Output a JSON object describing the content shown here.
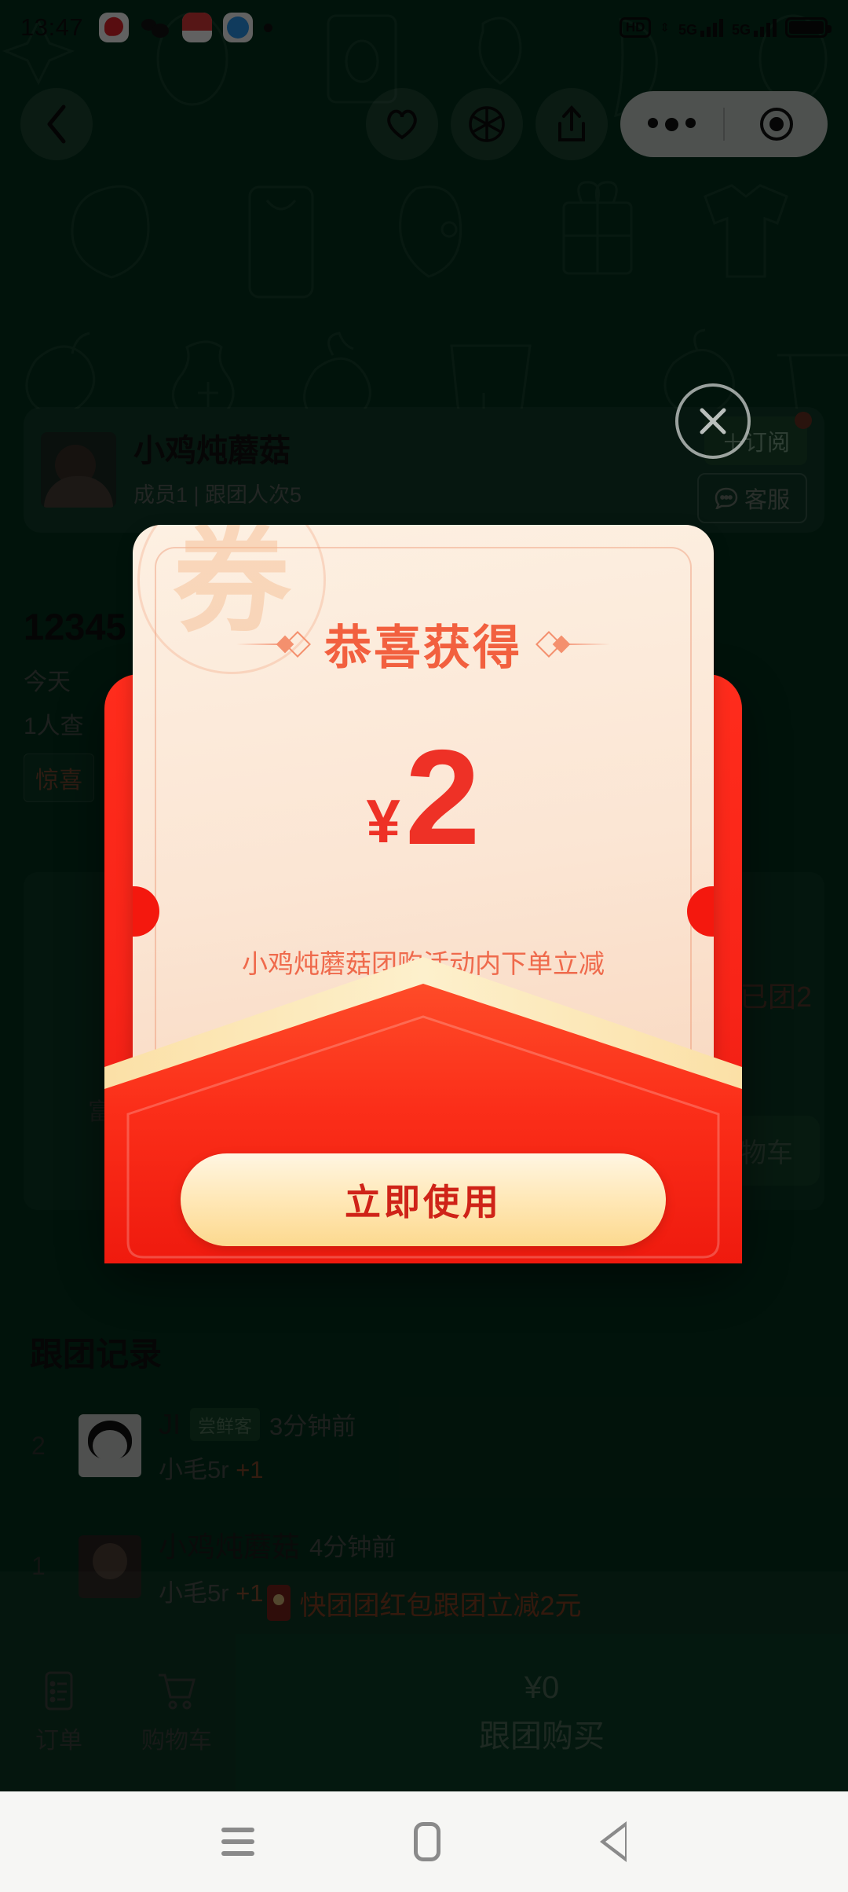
{
  "statusbar": {
    "time": "13:47",
    "network_hd": "HD",
    "net1": "5G",
    "net2": "5G",
    "icons": [
      "location-app-icon",
      "wechat-icon",
      "coupon-app-icon",
      "browser-app-icon",
      "notification-dot"
    ]
  },
  "nav": {
    "back": "‹",
    "favorite_icon": "heart-icon",
    "camera_icon": "aperture-icon",
    "share_icon": "share-icon",
    "more_icon": "more-dots-icon",
    "target_icon": "target-icon"
  },
  "shop": {
    "name": "小鸡炖蘑菇",
    "meta": "成员1 | 跟团人次5",
    "subscribe_label": "＋订阅",
    "service_label": "客服",
    "service_icon": "chat-icon"
  },
  "product": {
    "title": "12345",
    "line1": "今天",
    "line2": "1人查",
    "tag": "惊喜",
    "group_count": "已团2",
    "cart_label": "物车",
    "fav_label": "富"
  },
  "records": {
    "heading": "跟团记录",
    "items": [
      {
        "no": "2",
        "avatar": "panda-avatar",
        "user": "JI",
        "badge": "尝鲜客",
        "time": "3分钟前",
        "detail": "小毛5r",
        "plus": "+1"
      },
      {
        "no": "1",
        "avatar": "girl-avatar",
        "user": "小鸡炖蘑菇",
        "badge": "",
        "time": "4分钟前",
        "detail": "小毛5r",
        "plus": "+1"
      }
    ]
  },
  "promo": {
    "icon": "redpacket-icon",
    "text": "快团团红包跟团立减2元"
  },
  "tabbar": {
    "tabs": [
      {
        "icon": "order-list-icon",
        "label": "订单"
      },
      {
        "icon": "shopping-cart-icon",
        "label": "购物车"
      }
    ],
    "buy_price": "¥0",
    "buy_label": "跟团购买"
  },
  "modal": {
    "close_icon": "close-icon",
    "stamp_char": "券",
    "title": "恭喜获得",
    "currency": "¥",
    "amount": "2",
    "description": "小鸡炖蘑菇团购活动内下单立减",
    "action_label": "立即使用"
  },
  "android": {
    "recents_icon": "menu-icon",
    "home_icon": "home-icon",
    "back_icon": "back-triangle-icon"
  },
  "colors": {
    "page_bg": "#04331e",
    "packet_red": "#f4180e",
    "coupon_bg": "#fbe5d3",
    "amount_red": "#ee3126",
    "title_red": "#f2603f",
    "button_gold": "#ffe7b5",
    "buy_green": "#0b4128"
  }
}
